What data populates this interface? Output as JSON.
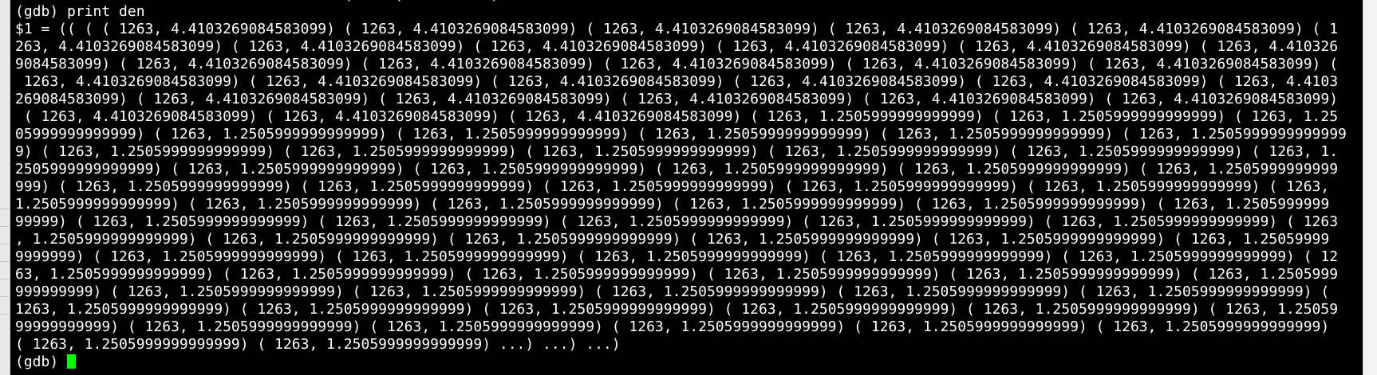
{
  "terminal": {
    "fg_color": "#ffffff",
    "bg_color": "#000000",
    "cursor_color": "#00ff00",
    "top_partial_line": "                                      (     ,          )",
    "lines": [
      "(gdb) print den",
      "$1 = (( ( ( 1263, 4.4103269084583099) ( 1263, 4.4103269084583099) ( 1263, 4.4103269084583099) ( 1263, 4.4103269084583099) ( 1263, 4.4103269084583099) ( 1",
      "263, 4.4103269084583099) ( 1263, 4.4103269084583099) ( 1263, 4.4103269084583099) ( 1263, 4.4103269084583099) ( 1263, 4.4103269084583099) ( 1263, 4.410326",
      "9084583099) ( 1263, 4.4103269084583099) ( 1263, 4.4103269084583099) ( 1263, 4.4103269084583099) ( 1263, 4.4103269084583099) ( 1263, 4.4103269084583099) (",
      " 1263, 4.4103269084583099) ( 1263, 4.4103269084583099) ( 1263, 4.4103269084583099) ( 1263, 4.4103269084583099) ( 1263, 4.4103269084583099) ( 1263, 4.4103",
      "269084583099) ( 1263, 4.4103269084583099) ( 1263, 4.4103269084583099) ( 1263, 4.4103269084583099) ( 1263, 4.4103269084583099) ( 1263, 4.4103269084583099)",
      " ( 1263, 4.4103269084583099) ( 1263, 4.4103269084583099) ( 1263, 4.4103269084583099) ( 1263, 1.2505999999999999) ( 1263, 1.2505999999999999) ( 1263, 1.25",
      "05999999999999) ( 1263, 1.2505999999999999) ( 1263, 1.2505999999999999) ( 1263, 1.2505999999999999) ( 1263, 1.2505999999999999) ( 1263, 1.2505999999999999",
      "9) ( 1263, 1.2505999999999999) ( 1263, 1.2505999999999999) ( 1263, 1.2505999999999999) ( 1263, 1.2505999999999999) ( 1263, 1.2505999999999999) ( 1263, 1.",
      "2505999999999999) ( 1263, 1.2505999999999999) ( 1263, 1.2505999999999999) ( 1263, 1.2505999999999999) ( 1263, 1.2505999999999999) ( 1263, 1.2505999999999",
      "999) ( 1263, 1.2505999999999999) ( 1263, 1.2505999999999999) ( 1263, 1.2505999999999999) ( 1263, 1.2505999999999999) ( 1263, 1.2505999999999999) ( 1263,",
      "1.2505999999999999) ( 1263, 1.2505999999999999) ( 1263, 1.2505999999999999) ( 1263, 1.2505999999999999) ( 1263, 1.2505999999999999) ( 1263, 1.2505999999",
      "99999) ( 1263, 1.2505999999999999) ( 1263, 1.2505999999999999) ( 1263, 1.2505999999999999) ( 1263, 1.2505999999999999) ( 1263, 1.2505999999999999) ( 1263",
      ", 1.2505999999999999) ( 1263, 1.2505999999999999) ( 1263, 1.2505999999999999) ( 1263, 1.2505999999999999) ( 1263, 1.2505999999999999) ( 1263, 1.25059999",
      "9999999) ( 1263, 1.2505999999999999) ( 1263, 1.2505999999999999) ( 1263, 1.2505999999999999) ( 1263, 1.2505999999999999) ( 1263, 1.2505999999999999) ( 12",
      "63, 1.2505999999999999) ( 1263, 1.2505999999999999) ( 1263, 1.2505999999999999) ( 1263, 1.2505999999999999) ( 1263, 1.2505999999999999) ( 1263, 1.2505999",
      "999999999) ( 1263, 1.2505999999999999) ( 1263, 1.2505999999999999) ( 1263, 1.2505999999999999) ( 1263, 1.2505999999999999) ( 1263, 1.2505999999999999) (",
      "1263, 1.2505999999999999) ( 1263, 1.2505999999999999) ( 1263, 1.2505999999999999) ( 1263, 1.2505999999999999) ( 1263, 1.2505999999999999) ( 1263, 1.25059",
      "99999999999) ( 1263, 1.2505999999999999) ( 1263, 1.2505999999999999) ( 1263, 1.2505999999999999) ( 1263, 1.2505999999999999) ( 1263, 1.2505999999999999)",
      "( 1263, 1.2505999999999999) ( 1263, 1.2505999999999999) ...) ...) ...)"
    ],
    "prompt": "(gdb) "
  }
}
